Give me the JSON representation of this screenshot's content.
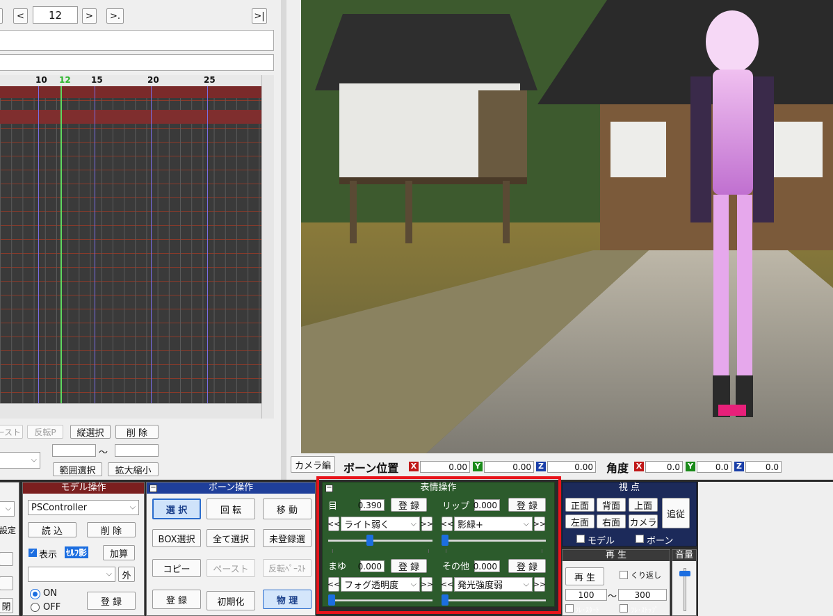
{
  "frame_nav": {
    "prev_label": "<",
    "frame_value": "12",
    "next_label": ">",
    "next_key_label": ">.",
    "end_label": ">|"
  },
  "timeline": {
    "ticks": [
      "10",
      "12",
      "15",
      "20",
      "25"
    ]
  },
  "tl_buttons": {
    "paste": "ペースト",
    "reverse_paste": "反転P",
    "vertical_select": "縦選択",
    "delete": "削 除",
    "range_select": "範囲選択",
    "scale": "拡大縮小",
    "range_tilde": "～"
  },
  "viewport": {
    "camera_edit": "カメラ編",
    "bone_pos_label": "ボーン位置",
    "bone_pos": {
      "x": "0.00",
      "y": "0.00",
      "z": "0.00"
    },
    "angle_label": "角度",
    "angle": {
      "x": "0.0",
      "y": "0.0",
      "z": "0.0"
    },
    "axes": {
      "x": "X",
      "y": "Y",
      "z": "Z"
    }
  },
  "left_partial": {
    "setting": "設定",
    "close": "閉"
  },
  "model_panel": {
    "title": "モデル操作",
    "model_select": "PSController",
    "load": "読 込",
    "delete": "削 除",
    "display": "表示",
    "self_shadow": "ｾﾙﾌ影",
    "add": "加算",
    "outside": "外",
    "on": "ON",
    "off": "OFF",
    "register": "登 録"
  },
  "bone_panel": {
    "title": "ボーン操作",
    "select": "選 択",
    "rotate": "回 転",
    "move": "移 動",
    "box_select": "BOX選択",
    "select_all": "全て選択",
    "unregistered_select": "未登録選",
    "copy": "コピー",
    "paste": "ペースト",
    "reverse_paste": "反転ﾍﾟｰｽﾄ",
    "register": "登 録",
    "initialize": "初期化",
    "physics": "物 理"
  },
  "expression_panel": {
    "title": "表情操作",
    "eye": {
      "label": "目",
      "value": "0.390",
      "register": "登 録",
      "morph": "ライト弱く",
      "slider": 0.39
    },
    "lip": {
      "label": "リップ",
      "value": "0.000",
      "register": "登 録",
      "morph": "影緑+",
      "slider": 0.0
    },
    "brow": {
      "label": "まゆ",
      "value": "0.000",
      "register": "登 録",
      "morph": "フォグ透明度",
      "slider": 0.0
    },
    "other": {
      "label": "その他",
      "value": "0.000",
      "register": "登 録",
      "morph": "発光強度弱",
      "slider": 0.0
    },
    "prev": "<<",
    "next": ">>"
  },
  "view_panel": {
    "title": "視 点",
    "front": "正面",
    "back": "背面",
    "top": "上面",
    "track": "追従",
    "left": "左面",
    "right": "右面",
    "camera": "カメラ",
    "model": "モデル",
    "bone": "ボーン"
  },
  "play_panel": {
    "title": "再 生",
    "play": "再 生",
    "repeat": "くり返し",
    "start": "100",
    "stop": "300",
    "tilde": "～",
    "frame_start": "ﾌﾚ･ｽﾀｰﾄ",
    "frame_stop": "ﾌﾚ･ｽﾄｯﾌﾟ"
  },
  "volume_panel": {
    "title": "音量",
    "level": 0.9
  },
  "colors": {
    "panel_blue": "#1f3f9a",
    "panel_green": "#2c5b2c",
    "panel_red": "#7b1f1f",
    "highlight": "#e8141b"
  }
}
